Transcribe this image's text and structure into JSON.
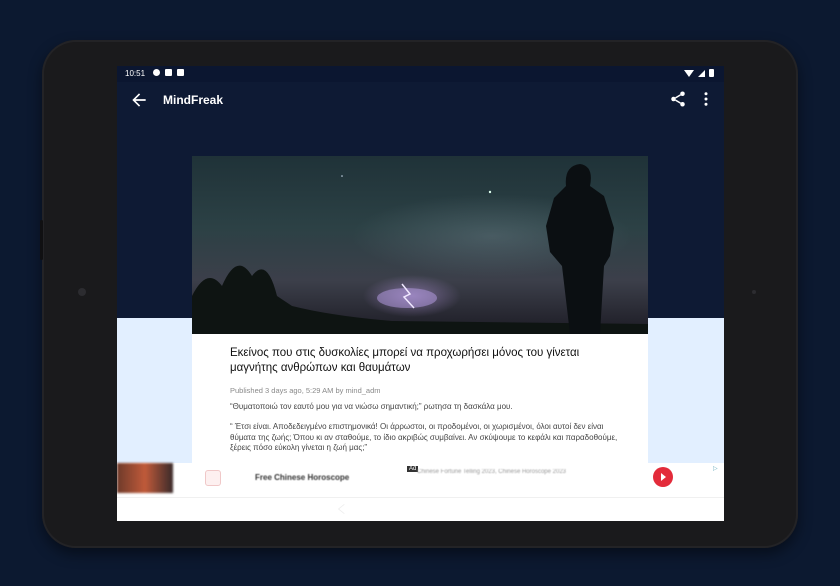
{
  "status_bar": {
    "time": "10:51",
    "left_icons": [
      "settings-icon",
      "notification-icon",
      "storage-icon"
    ],
    "right_icons": [
      "wifi-icon",
      "signal-icon",
      "battery-icon"
    ]
  },
  "app_bar": {
    "title": "MindFreak",
    "back_icon": "arrow-left-icon",
    "actions": [
      "share-icon",
      "more-vert-icon"
    ]
  },
  "article": {
    "title": "Εκείνος που στις δυσκολίες μπορεί να προχωρήσει μόνος του γίνεται μαγνήτης ανθρώπων και θαυμάτων",
    "meta": "Published 3 days ago, 5:29 AM by mind_adm",
    "paragraphs": [
      "“Θυματοποιώ τον εαυτό μου για να νιώσω σημαντική;” ρωτησα τη δασκάλα μου.",
      "“ Έτσι είναι. Αποδεδειγμένο επιστημονικά!  Οι άρρωστοι, οι προδομένοι, οι χωρισμένοι, όλοι αυτοί δεν είναι θύματα της ζωής; Όπου κι αν σταθούμε, το ίδιο ακριβώς συμβαίνει. Αν σκύψουμε το κεφάλι και παραδοθούμε, ξέρεις πόσο εύκολη γίνεται η ζωή μας;”"
    ]
  },
  "ad": {
    "name": "Free Chinese Horoscope",
    "label": "Ad",
    "description": "Chinese Fortune Telling 2023, Chinese Horoscope 2023",
    "cta_icon": "play-arrow-icon",
    "info_icon": "ad-choices-icon"
  },
  "colors": {
    "app_bar": "#0e1a34",
    "background_lower": "#e2efff",
    "cta": "#e32b3a",
    "device_frame": "#1a1a1c",
    "page_bg": "#0c1930"
  }
}
